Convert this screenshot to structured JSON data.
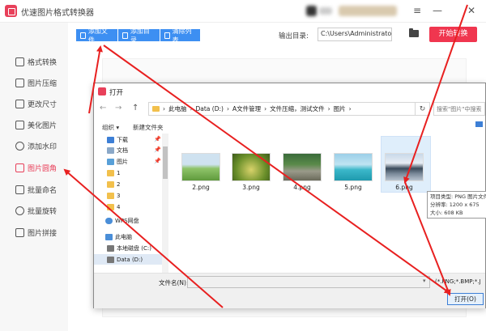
{
  "app": {
    "title": "优速图片格式转换器"
  },
  "window_controls": [
    {
      "name": "menu-icon",
      "glyph": "≡"
    },
    {
      "name": "minimize-icon",
      "glyph": "—"
    },
    {
      "name": "close-icon",
      "glyph": "✕"
    }
  ],
  "sidebar": {
    "items": [
      {
        "label": "格式转换",
        "active": false
      },
      {
        "label": "图片压缩",
        "active": false
      },
      {
        "label": "更改尺寸",
        "active": false
      },
      {
        "label": "美化图片",
        "active": false
      },
      {
        "label": "添加水印",
        "active": false
      },
      {
        "label": "图片圆角",
        "active": true
      },
      {
        "label": "批量命名",
        "active": false
      },
      {
        "label": "批量旋转",
        "active": false
      },
      {
        "label": "图片拼接",
        "active": false
      }
    ]
  },
  "toolbar": {
    "add_file": "添加文件",
    "add_folder": "添加目录",
    "clear_list": "清除列表",
    "output_label": "输出目录:",
    "output_value": "C:\\Users\\Administrator\\",
    "start": "开始转换"
  },
  "dialog": {
    "title": "打开",
    "back": "←",
    "forward": "→",
    "up": "↑",
    "breadcrumb": [
      "此电脑",
      "Data (D:)",
      "A文件管理",
      "文件压缩，测试文件",
      "图片"
    ],
    "search_placeholder": "搜索\"图片\"中搜索",
    "organize": "组织 ▾",
    "new_folder": "新建文件夹",
    "nav_items": [
      {
        "label": "下载",
        "pinned": true,
        "icon": "download-icon"
      },
      {
        "label": "文档",
        "pinned": true,
        "icon": "document-icon"
      },
      {
        "label": "图片",
        "pinned": true,
        "icon": "pictures-icon"
      },
      {
        "label": "1",
        "pinned": false,
        "icon": "folder-icon"
      },
      {
        "label": "2",
        "pinned": false,
        "icon": "folder-icon"
      },
      {
        "label": "3",
        "pinned": false,
        "icon": "folder-icon"
      },
      {
        "label": "4",
        "pinned": false,
        "icon": "folder-icon"
      },
      {
        "label": "WPS网盘",
        "pinned": false,
        "icon": "cloud-icon"
      },
      {
        "label": "此电脑",
        "pinned": false,
        "icon": "computer-icon"
      },
      {
        "label": "本地磁盘 (C:)",
        "pinned": false,
        "icon": "drive-icon"
      },
      {
        "label": "Data (D:)",
        "pinned": false,
        "icon": "drive-icon",
        "selected": true
      }
    ],
    "files": [
      {
        "name": "2.png"
      },
      {
        "name": "3.png"
      },
      {
        "name": "4.png"
      },
      {
        "name": "5.png"
      },
      {
        "name": "6.png",
        "selected": true
      }
    ],
    "tooltip": {
      "type": "项目类型: PNG 图片文件",
      "resolution": "分辨率: 1200 x 675",
      "size": "大小: 608 KB"
    },
    "filename_label": "文件名(N):",
    "filename_value": "",
    "filter": "(*.PNG;*.BMP;*.J",
    "open_button": "打开(O)"
  },
  "colors": {
    "accent": "#e8405a",
    "primary_blue": "#3d8ff2",
    "start_red": "#f0364f",
    "annotation_red": "#e82020"
  }
}
